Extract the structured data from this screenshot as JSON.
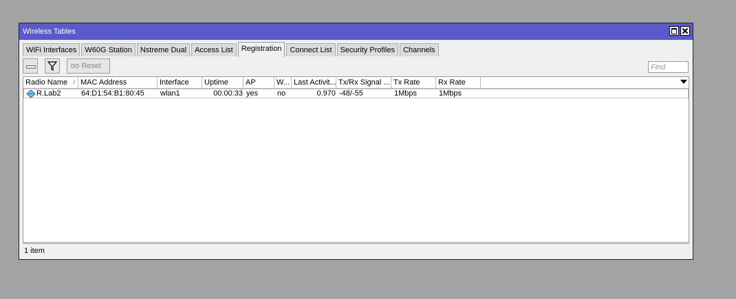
{
  "window": {
    "title": "Wireless Tables"
  },
  "tabs": [
    {
      "label": "WiFi Interfaces"
    },
    {
      "label": "W60G Station"
    },
    {
      "label": "Nstreme Dual"
    },
    {
      "label": "Access List"
    },
    {
      "label": "Registration"
    },
    {
      "label": "Connect List"
    },
    {
      "label": "Security Profiles"
    },
    {
      "label": "Channels"
    }
  ],
  "active_tab": "Registration",
  "toolbar": {
    "reset_label": "Reset",
    "find_placeholder": "Find"
  },
  "table": {
    "columns": [
      "Radio Name",
      "MAC Address",
      "Interface",
      "Uptime",
      "AP",
      "W...",
      "Last Activit...",
      "Tx/Rx Signal ...",
      "Tx Rate",
      "Rx Rate"
    ],
    "sort_indicator": "/",
    "rows": [
      {
        "radio_name": "R.Lab2",
        "mac_address": "64:D1:54:B1:80:45",
        "interface": "wlan1",
        "uptime": "00:00:33",
        "ap": "yes",
        "wds": "no",
        "last_activity": "0.970",
        "signal": "-48/-55",
        "tx_rate": "1Mbps",
        "rx_rate": "1Mbps"
      }
    ]
  },
  "status": {
    "text": "1 item"
  }
}
